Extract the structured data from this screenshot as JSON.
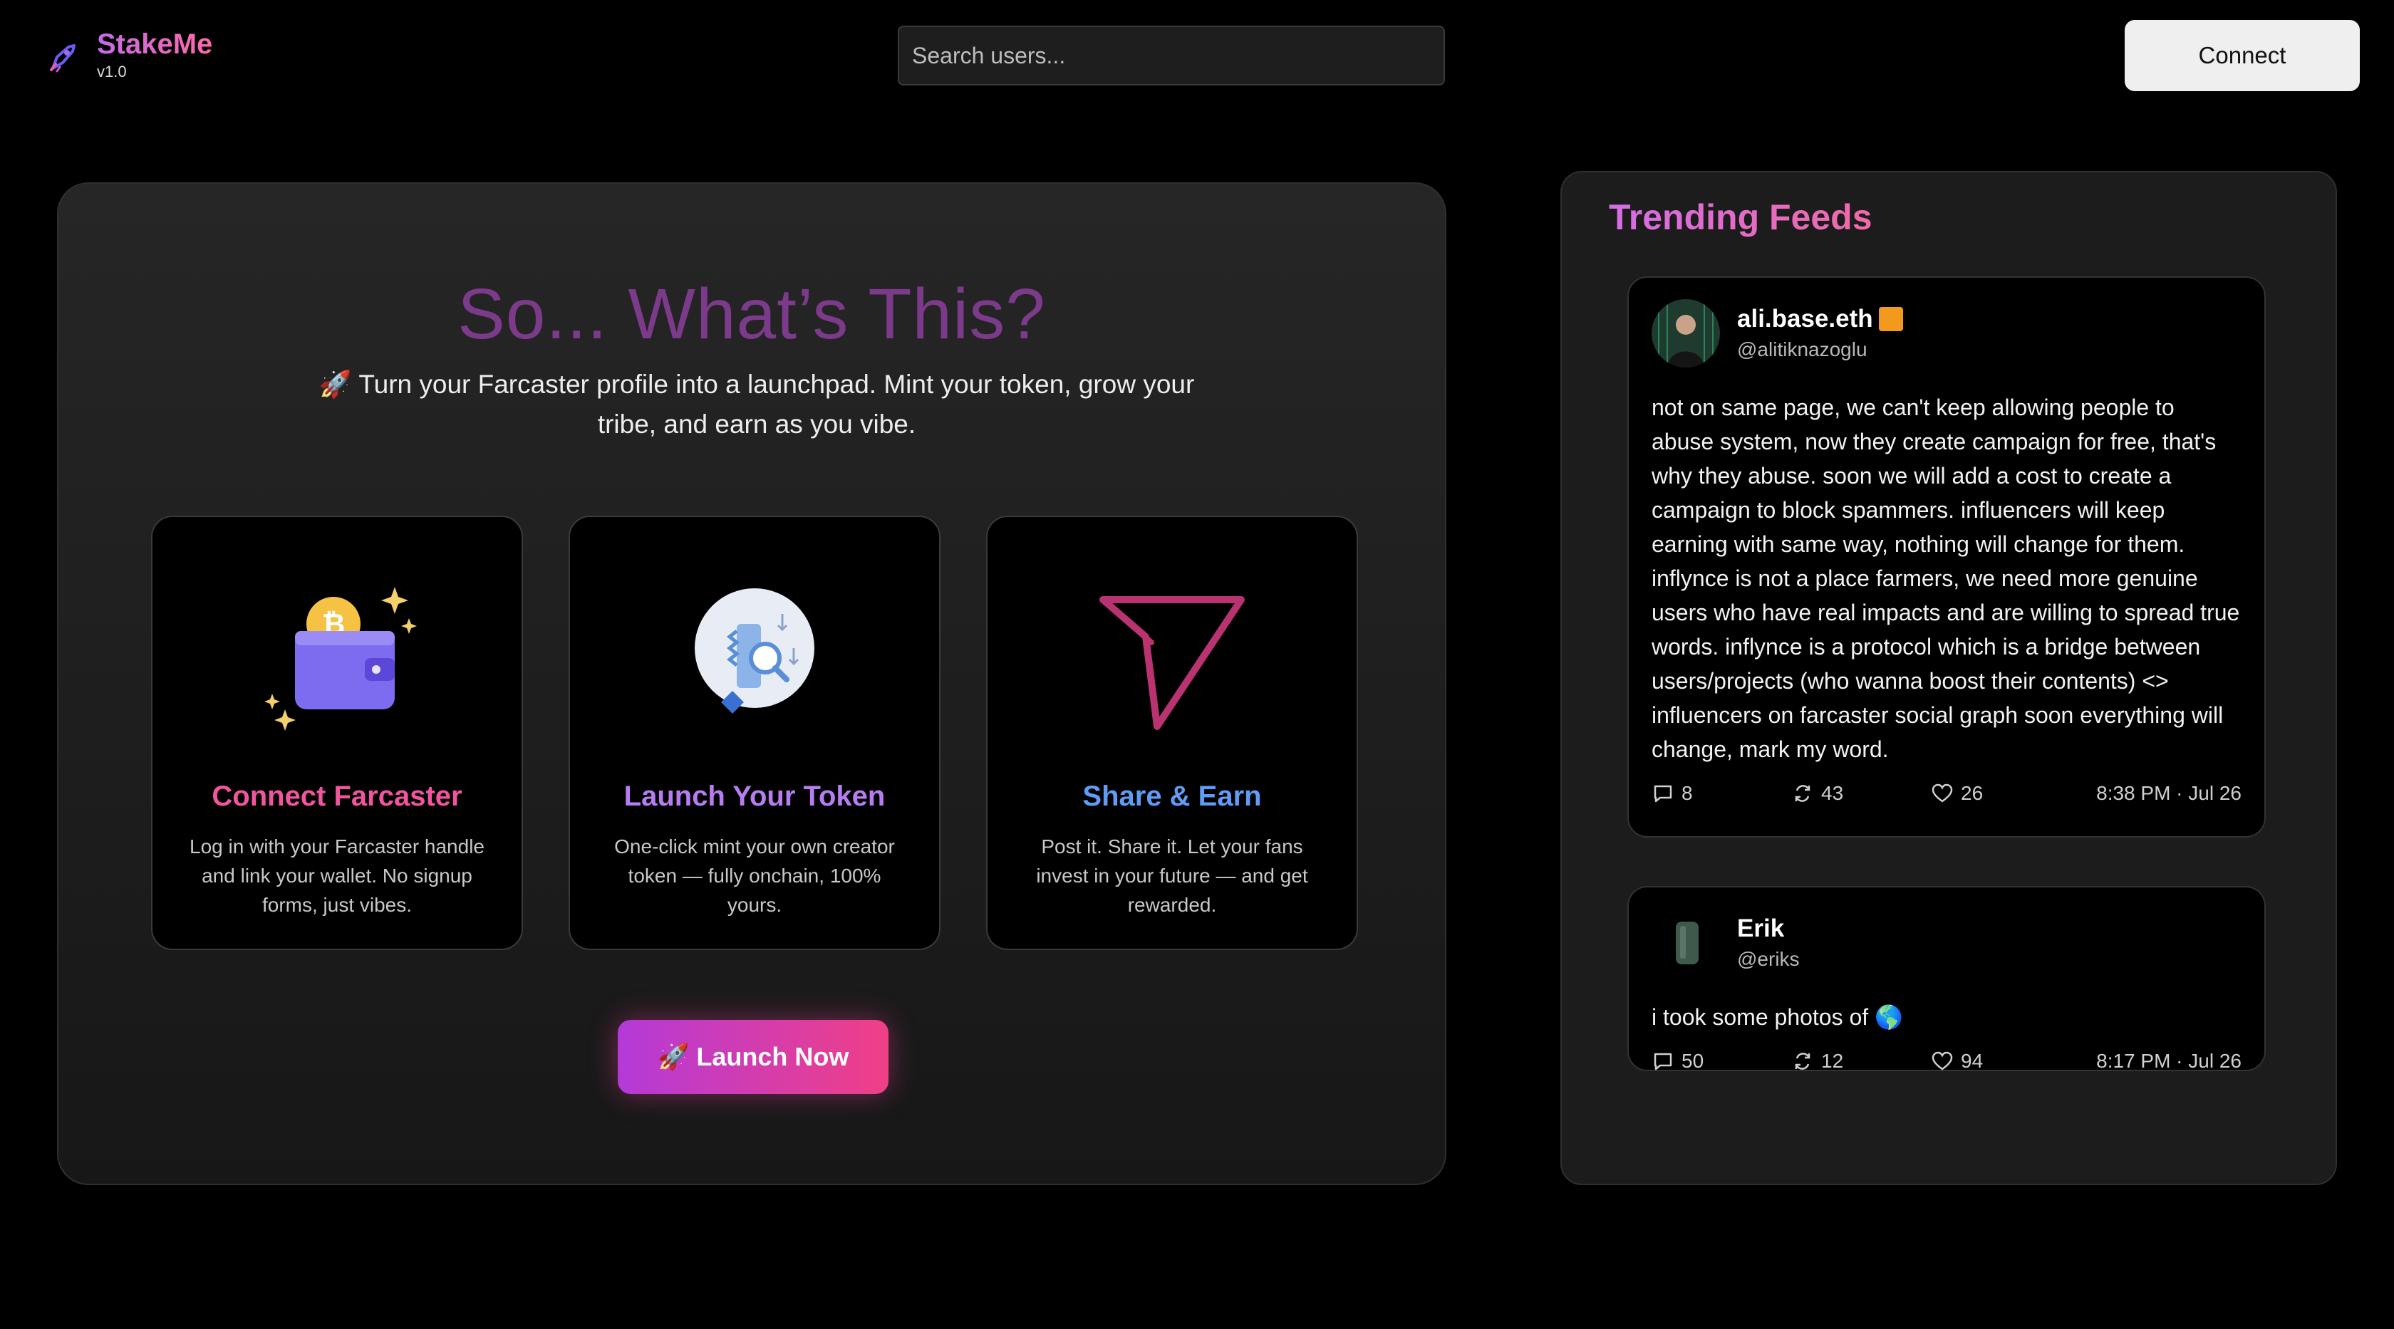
{
  "brand": {
    "name": "StakeMe",
    "version": "v1.0",
    "logo_icon": "rocket-icon"
  },
  "search": {
    "placeholder": "Search users..."
  },
  "header": {
    "connect_label": "Connect"
  },
  "hero": {
    "title": "So... What’s This?",
    "subtitle": "🚀 Turn your Farcaster profile into a launchpad. Mint your token, grow your tribe, and earn as you vibe.",
    "cards": [
      {
        "title": "Connect Farcaster",
        "description": "Log in with your Farcaster handle and link your wallet. No signup forms, just vibes.",
        "icon": "wallet-icon",
        "color": "#f0559e"
      },
      {
        "title": "Launch Your Token",
        "description": "One-click mint your own creator token — fully onchain, 100% yours.",
        "icon": "token-mint-icon",
        "color": "#b67df0"
      },
      {
        "title": "Share & Earn",
        "description": "Post it. Share it. Let your fans invest in your future — and get rewarded.",
        "icon": "send-icon",
        "color": "#5f9cf5"
      }
    ],
    "launch_label": "🚀 Launch Now"
  },
  "trending": {
    "title": "Trending Feeds",
    "posts": [
      {
        "name": "ali.base.eth",
        "handle": "@alitiknazoglu",
        "body": "not on same page, we can't keep allowing people to abuse system, now they create campaign for free, that's why they abuse. soon we will add a cost to create a campaign to block spammers. influencers will keep earning with same way, nothing will change for them. inflynce is not a place farmers, we need more genuine users who have real impacts and are willing to spread true words. inflynce is a protocol which is a bridge between users/projects (who wanna boost their contents) <> influencers on farcaster social graph soon everything will change, mark my word.",
        "replies": "8",
        "recasts": "43",
        "likes": "26",
        "time": "8:38 PM · Jul 26"
      },
      {
        "name": "Erik",
        "handle": "@eriks",
        "body": "i took some photos of 🌎",
        "replies": "50",
        "recasts": "12",
        "likes": "94",
        "time": "8:17 PM · Jul 26"
      }
    ]
  }
}
